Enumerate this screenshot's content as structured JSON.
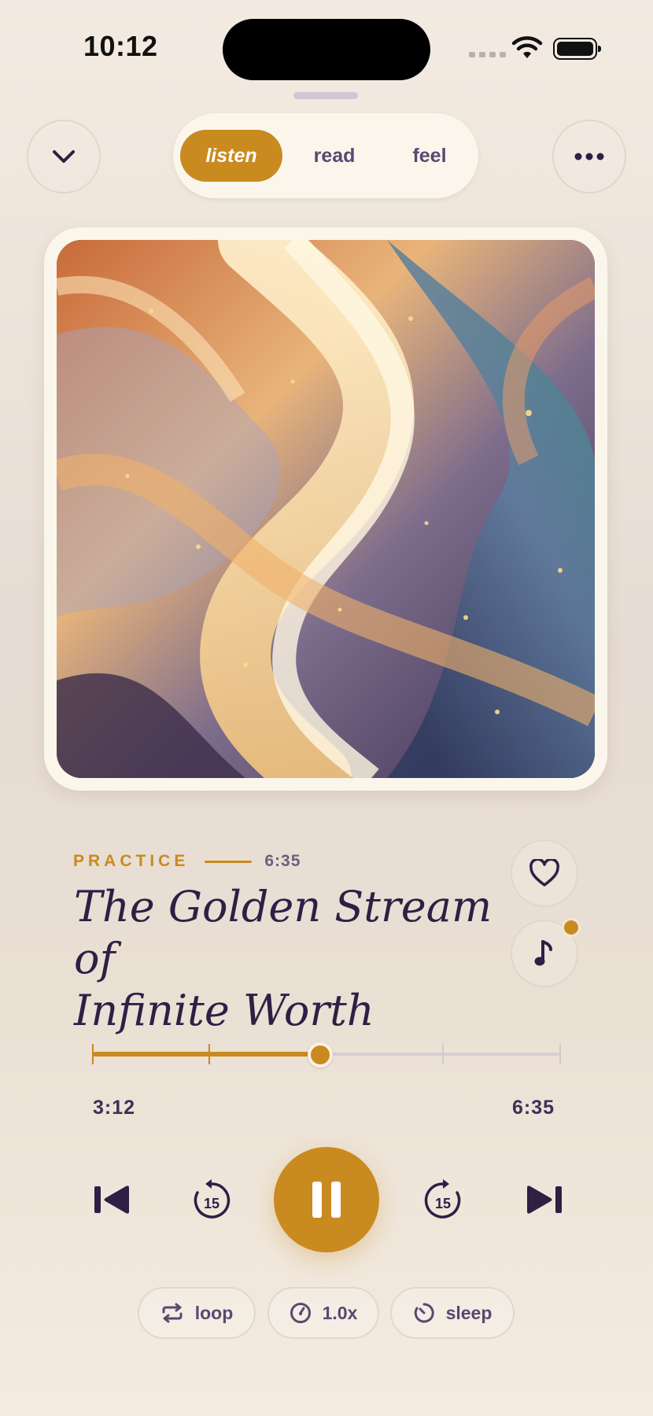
{
  "status_bar": {
    "time": "10:12"
  },
  "header": {
    "tabs": [
      {
        "label": "listen",
        "active": true
      },
      {
        "label": "read",
        "active": false
      },
      {
        "label": "feel",
        "active": false
      }
    ]
  },
  "track": {
    "category": "PRACTICE",
    "duration": "6:35",
    "title_line1": "The Golden Stream of",
    "title_line2": "Infinite Worth"
  },
  "progress": {
    "elapsed": "3:12",
    "total": "6:35",
    "fraction": 0.486
  },
  "options": {
    "loop_label": "loop",
    "speed_label": "1.0x",
    "sleep_label": "sleep"
  },
  "colors": {
    "accent": "#c98a1f",
    "text_primary": "#2e1f45",
    "tab_text": "#5a4870"
  }
}
